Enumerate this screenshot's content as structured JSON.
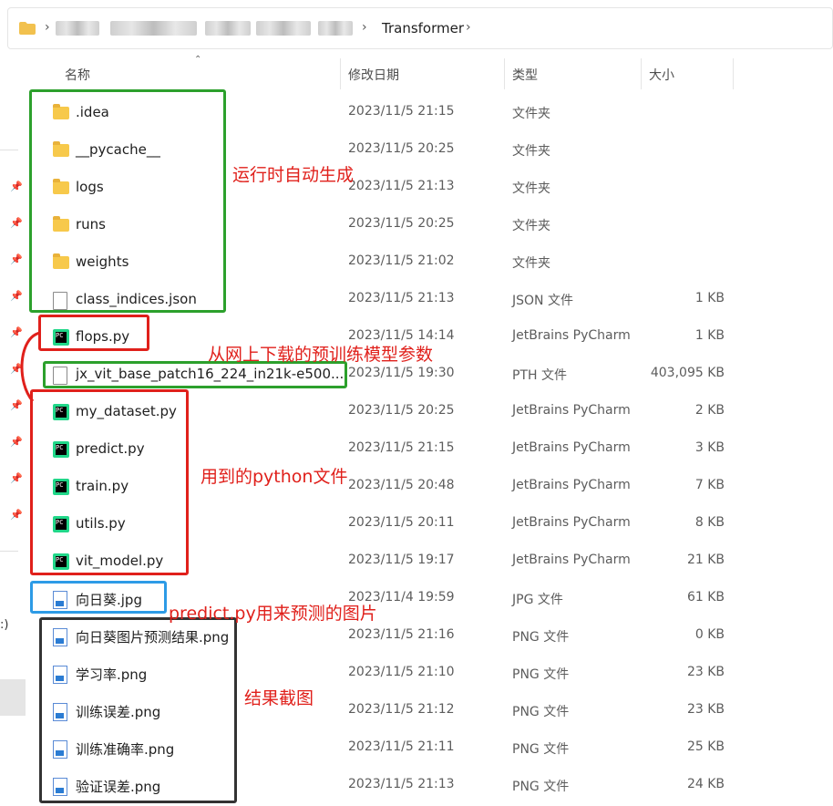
{
  "address_bar": {
    "current": "Transformer",
    "separator": "›"
  },
  "columns": {
    "name": "名称",
    "modified": "修改日期",
    "type": "类型",
    "size": "大小"
  },
  "nav": {
    "fragment": ":)"
  },
  "files": [
    {
      "name": ".idea",
      "date": "2023/11/5 21:15",
      "type": "文件夹",
      "size": "",
      "icon": "folder-icon"
    },
    {
      "name": "__pycache__",
      "date": "2023/11/5 20:25",
      "type": "文件夹",
      "size": "",
      "icon": "folder-icon"
    },
    {
      "name": "logs",
      "date": "2023/11/5 21:13",
      "type": "文件夹",
      "size": "",
      "icon": "folder-icon"
    },
    {
      "name": "runs",
      "date": "2023/11/5 20:25",
      "type": "文件夹",
      "size": "",
      "icon": "folder-icon"
    },
    {
      "name": "weights",
      "date": "2023/11/5 21:02",
      "type": "文件夹",
      "size": "",
      "icon": "folder-icon"
    },
    {
      "name": "class_indices.json",
      "date": "2023/11/5 21:13",
      "type": "JSON 文件",
      "size": "1 KB",
      "icon": "file-icon"
    },
    {
      "name": "flops.py",
      "date": "2023/11/5 14:14",
      "type": "JetBrains PyCharm",
      "size": "1 KB",
      "icon": "pycharm-icon"
    },
    {
      "name": "jx_vit_base_patch16_224_in21k-e500...",
      "date": "2023/11/5 19:30",
      "type": "PTH 文件",
      "size": "403,095 KB",
      "icon": "file-icon"
    },
    {
      "name": "my_dataset.py",
      "date": "2023/11/5 20:25",
      "type": "JetBrains PyCharm",
      "size": "2 KB",
      "icon": "pycharm-icon"
    },
    {
      "name": "predict.py",
      "date": "2023/11/5 21:15",
      "type": "JetBrains PyCharm",
      "size": "3 KB",
      "icon": "pycharm-icon"
    },
    {
      "name": "train.py",
      "date": "2023/11/5 20:48",
      "type": "JetBrains PyCharm",
      "size": "7 KB",
      "icon": "pycharm-icon"
    },
    {
      "name": "utils.py",
      "date": "2023/11/5 20:11",
      "type": "JetBrains PyCharm",
      "size": "8 KB",
      "icon": "pycharm-icon"
    },
    {
      "name": "vit_model.py",
      "date": "2023/11/5 19:17",
      "type": "JetBrains PyCharm",
      "size": "21 KB",
      "icon": "pycharm-icon"
    },
    {
      "name": "向日葵.jpg",
      "date": "2023/11/4 19:59",
      "type": "JPG 文件",
      "size": "61 KB",
      "icon": "image-icon"
    },
    {
      "name": "向日葵图片预测结果.png",
      "date": "2023/11/5 21:16",
      "type": "PNG 文件",
      "size": "0 KB",
      "icon": "image-icon"
    },
    {
      "name": "学习率.png",
      "date": "2023/11/5 21:10",
      "type": "PNG 文件",
      "size": "23 KB",
      "icon": "image-icon"
    },
    {
      "name": "训练误差.png",
      "date": "2023/11/5 21:12",
      "type": "PNG 文件",
      "size": "23 KB",
      "icon": "image-icon"
    },
    {
      "name": "训练准确率.png",
      "date": "2023/11/5 21:11",
      "type": "PNG 文件",
      "size": "25 KB",
      "icon": "image-icon"
    },
    {
      "name": "验证误差.png",
      "date": "2023/11/5 21:13",
      "type": "PNG 文件",
      "size": "24 KB",
      "icon": "image-icon"
    }
  ],
  "annotations": {
    "auto_generated": "运行时自动生成",
    "downloaded_params": "从网上下载的预训练模型参数",
    "python_files": "用到的python文件",
    "predict_image": "predict.py用来预测的图片",
    "result_screens": "结果截图"
  },
  "colors": {
    "green": "#2ca02c",
    "red": "#e0201b",
    "blue": "#2d9be6",
    "black": "#333333",
    "text_red": "#e0201b"
  }
}
